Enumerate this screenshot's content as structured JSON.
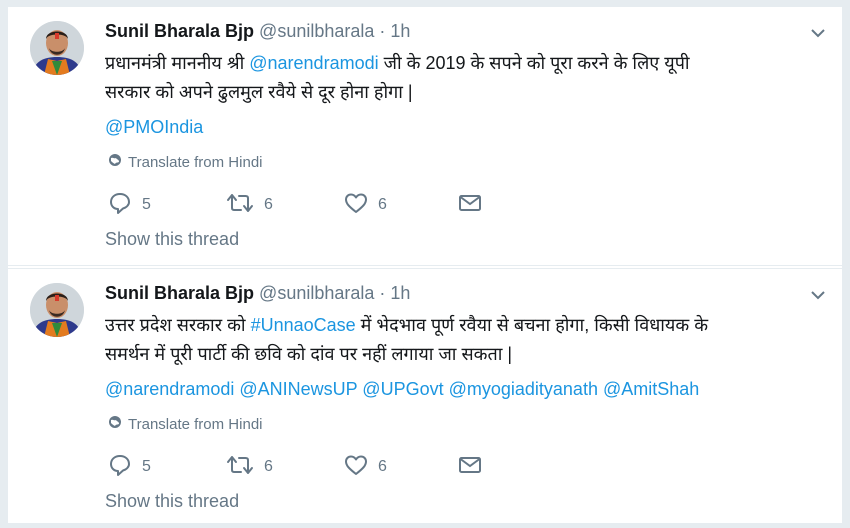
{
  "tweets": [
    {
      "name": "Sunil Bharala Bjp",
      "handle": "@sunilbharala",
      "dot": "·",
      "time": "1h",
      "line1_a": "प्रधानमंत्री माननीय श्री ",
      "line1_mention": "@narendramodi",
      "line1_b": " जी के 2019 के सपने को पूरा करने के लिए यूपी",
      "line2": "सरकार को अपने ढुलमुल रवैये से दूर होना होगा |",
      "mentions": "@PMOIndia",
      "translate": "Translate from Hindi",
      "replies": "5",
      "retweets": "6",
      "likes": "6",
      "show_thread": "Show this thread"
    },
    {
      "name": "Sunil Bharala Bjp",
      "handle": "@sunilbharala",
      "dot": "·",
      "time": "1h",
      "line1_a": "उत्तर प्रदेश सरकार को ",
      "line1_hashtag": "#UnnaoCase",
      "line1_b": " में भेदभाव पूर्ण रवैया से बचना होगा, किसी विधायक के",
      "line2": "समर्थन में पूरी पार्टी की छवि को दांव पर नहीं लगाया जा सकता |",
      "mentions": "@narendramodi @ANINewsUP @UPGovt @myogiadityanath @AmitShah",
      "translate": "Translate from Hindi",
      "replies": "5",
      "retweets": "6",
      "likes": "6",
      "show_thread": "Show this thread"
    }
  ],
  "icons": {
    "reply": "reply-icon",
    "retweet": "retweet-icon",
    "like": "heart-icon",
    "dm": "envelope-icon",
    "globe": "globe-icon",
    "caret": "chevron-down-icon"
  },
  "colors": {
    "link": "#1b95e0",
    "secondary": "#657786",
    "text": "#14171a",
    "background": "#e6ecf0"
  }
}
